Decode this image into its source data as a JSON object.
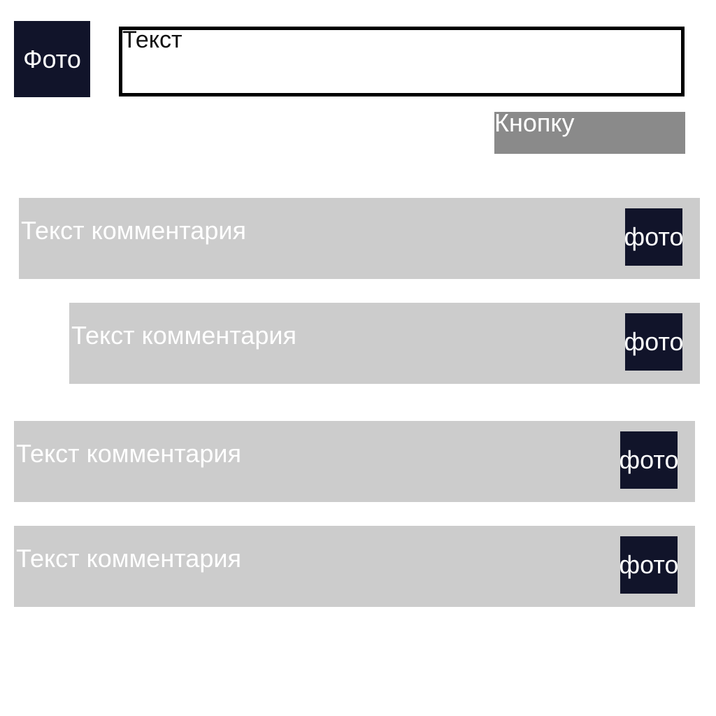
{
  "composer": {
    "photo_label": "Фото",
    "input_placeholder": "Текст",
    "submit_label": "Кнопку"
  },
  "comments": [
    {
      "text": "Текст комментария",
      "photo_label": "фото"
    },
    {
      "text": "Текст комментария",
      "photo_label": "фото"
    },
    {
      "text": "Текст комментария",
      "photo_label": "фото"
    },
    {
      "text": "Текст комментария",
      "photo_label": "фото"
    }
  ],
  "colors": {
    "photo_bg": "#11142a",
    "comment_bg": "#cccccc",
    "button_bg": "#8a8a8a",
    "input_border": "#000000"
  }
}
